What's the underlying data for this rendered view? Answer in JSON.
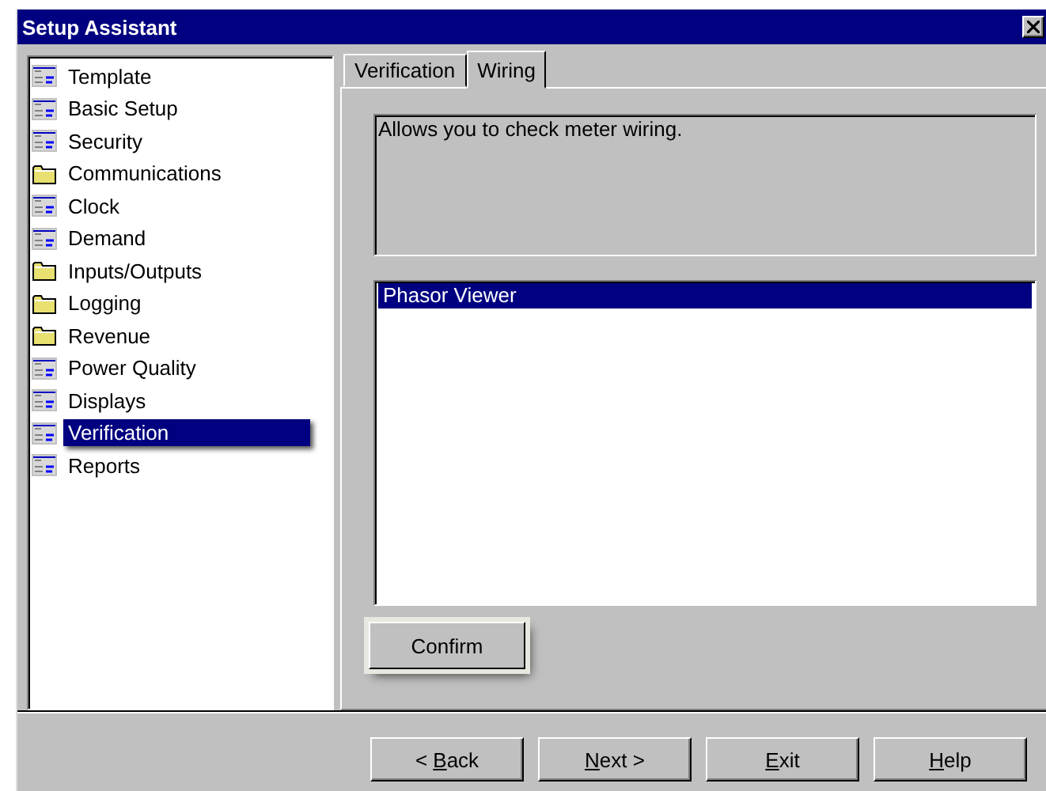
{
  "window": {
    "title": "Setup Assistant"
  },
  "sidebar": {
    "items": [
      {
        "label": "Template",
        "kind": "page",
        "selected": false
      },
      {
        "label": "Basic Setup",
        "kind": "page",
        "selected": false
      },
      {
        "label": "Security",
        "kind": "page",
        "selected": false
      },
      {
        "label": "Communications",
        "kind": "folder",
        "selected": false
      },
      {
        "label": "Clock",
        "kind": "page",
        "selected": false
      },
      {
        "label": "Demand",
        "kind": "page",
        "selected": false
      },
      {
        "label": "Inputs/Outputs",
        "kind": "folder",
        "selected": false
      },
      {
        "label": "Logging",
        "kind": "folder",
        "selected": false
      },
      {
        "label": "Revenue",
        "kind": "folder",
        "selected": false
      },
      {
        "label": "Power Quality",
        "kind": "page",
        "selected": false
      },
      {
        "label": "Displays",
        "kind": "page",
        "selected": false
      },
      {
        "label": "Verification",
        "kind": "page",
        "selected": true
      },
      {
        "label": "Reports",
        "kind": "page",
        "selected": false
      }
    ]
  },
  "tabs": [
    {
      "label": "Verification",
      "selected": false
    },
    {
      "label": "Wiring",
      "selected": true
    }
  ],
  "description": "Allows you to check meter wiring.",
  "list": {
    "items": [
      {
        "label": "Phasor Viewer",
        "selected": true
      }
    ]
  },
  "confirm_button": "Confirm",
  "buttons": [
    {
      "pre": "< ",
      "key": "B",
      "post": "ack"
    },
    {
      "key": "N",
      "post": "ext >"
    },
    {
      "key": "E",
      "post": "xit"
    },
    {
      "key": "H",
      "post": "elp"
    }
  ]
}
